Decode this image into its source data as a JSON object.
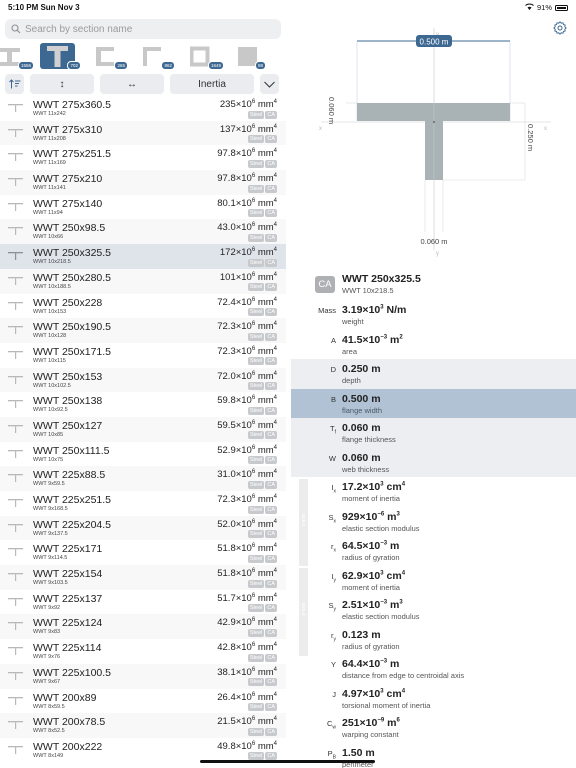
{
  "status": {
    "time": "5:10 PM  Sun Nov 3",
    "battery": "91%"
  },
  "search": {
    "placeholder": "Search by section name",
    "value": ""
  },
  "shape_types": [
    {
      "name": "I-beam",
      "count": "1556",
      "selected": false
    },
    {
      "name": "T-section",
      "count": "702",
      "selected": true
    },
    {
      "name": "Channel",
      "count": "265",
      "selected": false
    },
    {
      "name": "Angle",
      "count": "862",
      "selected": false
    },
    {
      "name": "Hollow",
      "count": "1649",
      "selected": false
    },
    {
      "name": "Solid",
      "count": "98",
      "selected": false
    }
  ],
  "sortbar": {
    "sort_icon": "sort-icon",
    "vertical": "↕",
    "horizontal": "↔",
    "property": "Inertia",
    "dropdown": "⌄"
  },
  "sections": [
    {
      "name": "WWT 275x360.5",
      "imperial": "WWT 11x242",
      "value": "235×10",
      "exp": "6",
      "unit": " mm",
      "uexp": "4"
    },
    {
      "name": "WWT 275x310",
      "imperial": "WWT 11x208",
      "value": "137×10",
      "exp": "6",
      "unit": " mm",
      "uexp": "4"
    },
    {
      "name": "WWT 275x251.5",
      "imperial": "WWT 11x169",
      "value": "97.8×10",
      "exp": "6",
      "unit": " mm",
      "uexp": "4"
    },
    {
      "name": "WWT 275x210",
      "imperial": "WWT 11x141",
      "value": "97.8×10",
      "exp": "6",
      "unit": " mm",
      "uexp": "4"
    },
    {
      "name": "WWT 275x140",
      "imperial": "WWT 11x94",
      "value": "80.1×10",
      "exp": "6",
      "unit": " mm",
      "uexp": "4"
    },
    {
      "name": "WWT 250x98.5",
      "imperial": "WWT 10x66",
      "value": "43.0×10",
      "exp": "6",
      "unit": " mm",
      "uexp": "4"
    },
    {
      "name": "WWT 250x325.5",
      "imperial": "WWT 10x218.5",
      "value": "172×10",
      "exp": "6",
      "unit": " mm",
      "uexp": "4",
      "selected": true
    },
    {
      "name": "WWT 250x280.5",
      "imperial": "WWT 10x188.5",
      "value": "101×10",
      "exp": "6",
      "unit": " mm",
      "uexp": "4"
    },
    {
      "name": "WWT 250x228",
      "imperial": "WWT 10x153",
      "value": "72.4×10",
      "exp": "6",
      "unit": " mm",
      "uexp": "4"
    },
    {
      "name": "WWT 250x190.5",
      "imperial": "WWT 10x128",
      "value": "72.3×10",
      "exp": "6",
      "unit": " mm",
      "uexp": "4"
    },
    {
      "name": "WWT 250x171.5",
      "imperial": "WWT 10x115",
      "value": "72.3×10",
      "exp": "6",
      "unit": " mm",
      "uexp": "4"
    },
    {
      "name": "WWT 250x153",
      "imperial": "WWT 10x102.5",
      "value": "72.0×10",
      "exp": "6",
      "unit": " mm",
      "uexp": "4"
    },
    {
      "name": "WWT 250x138",
      "imperial": "WWT 10x92.5",
      "value": "59.8×10",
      "exp": "6",
      "unit": " mm",
      "uexp": "4"
    },
    {
      "name": "WWT 250x127",
      "imperial": "WWT 10x85",
      "value": "59.5×10",
      "exp": "6",
      "unit": " mm",
      "uexp": "4"
    },
    {
      "name": "WWT 250x111.5",
      "imperial": "WWT 10x75",
      "value": "52.9×10",
      "exp": "6",
      "unit": " mm",
      "uexp": "4"
    },
    {
      "name": "WWT 225x88.5",
      "imperial": "WWT 9x59.5",
      "value": "31.0×10",
      "exp": "6",
      "unit": " mm",
      "uexp": "4"
    },
    {
      "name": "WWT 225x251.5",
      "imperial": "WWT 9x168.5",
      "value": "72.3×10",
      "exp": "6",
      "unit": " mm",
      "uexp": "4"
    },
    {
      "name": "WWT 225x204.5",
      "imperial": "WWT 9x137.5",
      "value": "52.0×10",
      "exp": "6",
      "unit": " mm",
      "uexp": "4"
    },
    {
      "name": "WWT 225x171",
      "imperial": "WWT 9x114.5",
      "value": "51.8×10",
      "exp": "6",
      "unit": " mm",
      "uexp": "4"
    },
    {
      "name": "WWT 225x154",
      "imperial": "WWT 9x103.5",
      "value": "51.8×10",
      "exp": "6",
      "unit": " mm",
      "uexp": "4"
    },
    {
      "name": "WWT 225x137",
      "imperial": "WWT 9x92",
      "value": "51.7×10",
      "exp": "6",
      "unit": " mm",
      "uexp": "4"
    },
    {
      "name": "WWT 225x124",
      "imperial": "WWT 9x83",
      "value": "42.9×10",
      "exp": "6",
      "unit": " mm",
      "uexp": "4"
    },
    {
      "name": "WWT 225x114",
      "imperial": "WWT 9x76",
      "value": "42.8×10",
      "exp": "6",
      "unit": " mm",
      "uexp": "4"
    },
    {
      "name": "WWT 225x100.5",
      "imperial": "WWT 9x67",
      "value": "38.1×10",
      "exp": "6",
      "unit": " mm",
      "uexp": "4"
    },
    {
      "name": "WWT 200x89",
      "imperial": "WWT 8x59.5",
      "value": "26.4×10",
      "exp": "6",
      "unit": " mm",
      "uexp": "4"
    },
    {
      "name": "WWT 200x78.5",
      "imperial": "WWT 8x52.5",
      "value": "21.5×10",
      "exp": "6",
      "unit": " mm",
      "uexp": "4"
    },
    {
      "name": "WWT 200x222",
      "imperial": "WWT 8x149",
      "value": "49.8×10",
      "exp": "6",
      "unit": " mm",
      "uexp": "4"
    }
  ],
  "tags": {
    "material": "Steel",
    "region": "CA"
  },
  "diagram": {
    "flange_width_label": "0.500 m",
    "flange_thickness_label": "0.060 m",
    "depth_label": "0.250 m",
    "web_thickness_label": "0.060 m",
    "x_axis": "x",
    "y_axis": "y"
  },
  "detail": {
    "region": "CA",
    "name": "WWT 250x325.5",
    "imperial": "WWT 10x218.5",
    "properties": [
      {
        "sym": "Mass",
        "value": "3.19×10",
        "exp": "3",
        "unit": " N/m",
        "uexp": "",
        "desc": "weight",
        "style": ""
      },
      {
        "sym": "A",
        "value": "41.5×10",
        "exp": "−3",
        "unit": " m",
        "uexp": "2",
        "desc": "area",
        "style": ""
      },
      {
        "sym": "D",
        "value": "0.250 m",
        "exp": "",
        "unit": "",
        "uexp": "",
        "desc": "depth",
        "style": "shade"
      },
      {
        "sym": "B",
        "value": "0.500 m",
        "exp": "",
        "unit": "",
        "uexp": "",
        "desc": "flange width",
        "style": "hl"
      },
      {
        "sym": "T",
        "symsub": "f",
        "value": "0.060 m",
        "exp": "",
        "unit": "",
        "uexp": "",
        "desc": "flange thickness",
        "style": "shade"
      },
      {
        "sym": "W",
        "value": "0.060 m",
        "exp": "",
        "unit": "",
        "uexp": "",
        "desc": "web thickness",
        "style": "shade"
      },
      {
        "sym": "I",
        "symsub": "x",
        "value": "17.2×10",
        "exp": "3",
        "unit": " cm",
        "uexp": "4",
        "desc": "moment of inertia",
        "style": ""
      },
      {
        "sym": "S",
        "symsub": "x",
        "value": "929×10",
        "exp": "−6",
        "unit": " m",
        "uexp": "3",
        "desc": "elastic section modulus",
        "style": ""
      },
      {
        "sym": "r",
        "symsub": "x",
        "value": "64.5×10",
        "exp": "−3",
        "unit": " m",
        "uexp": "",
        "desc": "radius of gyration",
        "style": ""
      },
      {
        "sym": "I",
        "symsub": "y",
        "value": "62.9×10",
        "exp": "3",
        "unit": " cm",
        "uexp": "4",
        "desc": "moment of inertia",
        "style": ""
      },
      {
        "sym": "S",
        "symsub": "y",
        "value": "2.51×10",
        "exp": "−3",
        "unit": " m",
        "uexp": "3",
        "desc": "elastic section modulus",
        "style": ""
      },
      {
        "sym": "r",
        "symsub": "y",
        "value": "0.123 m",
        "exp": "",
        "unit": "",
        "uexp": "",
        "desc": "radius of gyration",
        "style": ""
      },
      {
        "sym": "Y",
        "value": "64.4×10",
        "exp": "−3",
        "unit": " m",
        "uexp": "",
        "desc": "distance from edge to centroidal axis",
        "style": ""
      },
      {
        "sym": "J",
        "value": "4.97×10",
        "exp": "3",
        "unit": " cm",
        "uexp": "4",
        "desc": "torsional moment of inertia",
        "style": ""
      },
      {
        "sym": "C",
        "symsub": "w",
        "value": "251×10",
        "exp": "−9",
        "unit": " m",
        "uexp": "6",
        "desc": "warping constant",
        "style": ""
      },
      {
        "sym": "P",
        "symsub": "B",
        "value": "1.50 m",
        "exp": "",
        "unit": "",
        "uexp": "",
        "desc": "perimeter",
        "style": ""
      }
    ],
    "axis_groups": {
      "x": "x-axis",
      "y": "y-axis"
    }
  },
  "colors": {
    "accent": "#3d6891",
    "highlight_row": "#b0c2d3",
    "selected_list_row": "#dfe4eb",
    "section_fill": "#a9b3b6"
  }
}
